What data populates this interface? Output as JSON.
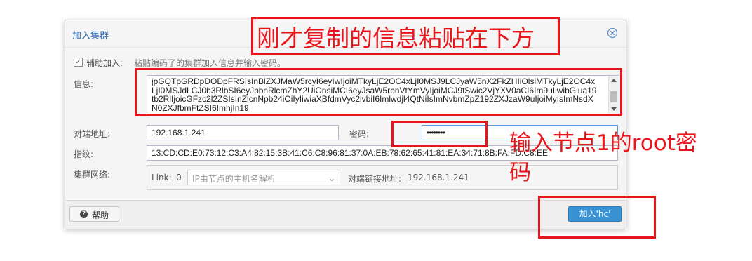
{
  "dialog": {
    "title": "加入集群",
    "assisted_join_label": "辅助加入:",
    "assisted_join_hint": "粘贴编码了的集群加入信息并输入密码。",
    "assisted_join_checked": true,
    "info_label": "信息:",
    "info_value": "jpGQTpGRDpDODpFRSIsInBlZXJMaW5rcyI6eyIwIjoiMTkyLjE2OC4xLjI0MSJ9LCJyaW5nX2FkZHIiOlsiMTkyLjE2OC4xLjI0MSJdLCJ0b3RlbSI6eyJpbnRlcmZhY2UiOnsiMCI6eyJsaW5rbnVtYmVyIjoiMCJ9fSwic2VjYXV0aCI6Im9uIiwibGlua19tb2RlIjoicGFzc2l2ZSIsInZlcnNpb24iOiIyIiwiaXBfdmVyc2lvbiI6Imlwdjl4QtNiIsImNvbmZpZ192ZXJzaW9uIjoiMyIsImNsdXN0ZXJfbmFtZSI6ImhjIn19",
    "peer_address_label": "对端地址:",
    "peer_address_value": "192.168.1.241",
    "password_label": "密码:",
    "password_value": "••••••••",
    "fingerprint_label": "指纹:",
    "fingerprint_value": "13:CD:CD:E0:73:12:C3:A4:82:15:3B:41:C6:C8:96:81:37:0A:EB:78:62:65:41:81:EA:34:71:8B:FA:FD:C8:EE",
    "cluster_network_label": "集群网络:",
    "link_label": "Link:",
    "link_number": "0",
    "link_select_placeholder": "IP由节点的主机名解析",
    "peer_link_label": "对端链接地址:",
    "peer_link_value": "192.168.1.241",
    "help_label": "帮助",
    "join_label": "加入'hc'"
  },
  "annotations": {
    "top_note": "刚才复制的信息粘贴在下方",
    "password_note_line1": "输入节点1的root密",
    "password_note_line2": "码",
    "color": "#e8151b"
  }
}
